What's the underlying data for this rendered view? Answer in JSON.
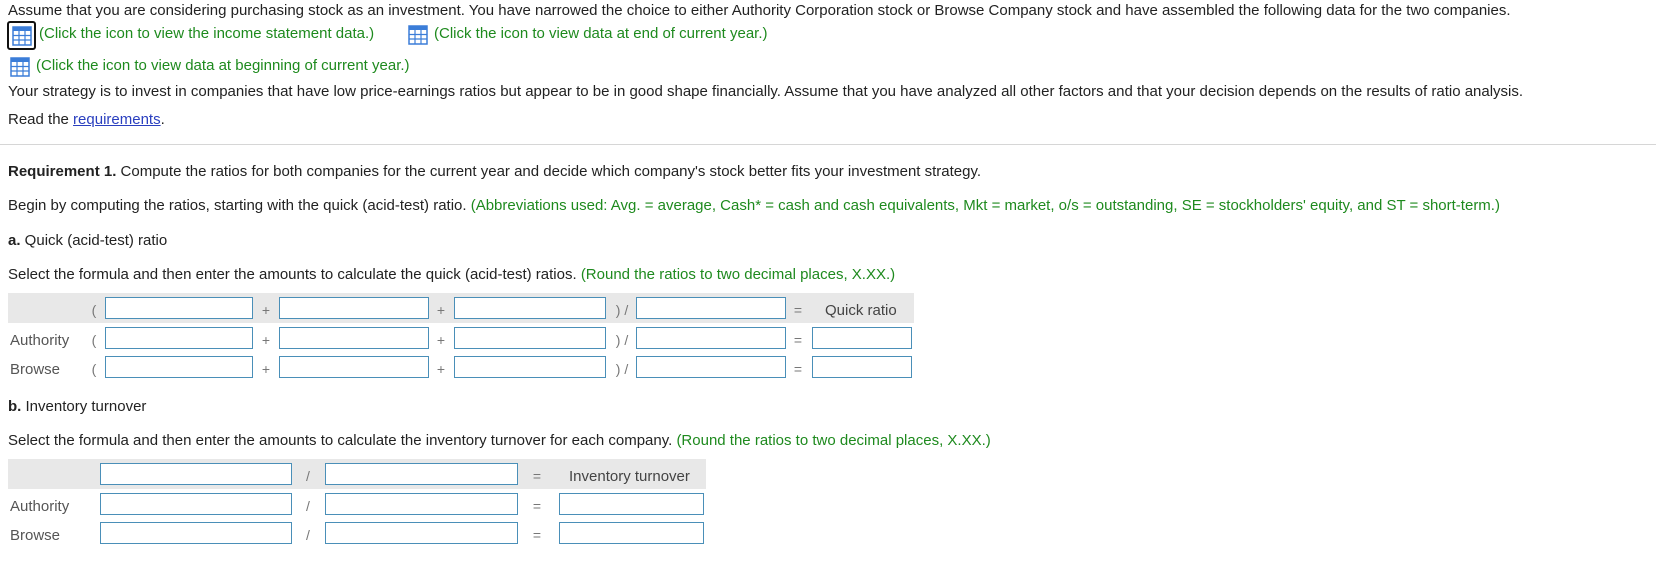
{
  "intro": {
    "text": "Assume that you are considering purchasing stock as an investment. You have narrowed the choice to either Authority Corporation stock or Browse Company stock and have assembled the following data for the two companies.",
    "link_income": "(Click the icon to view the income statement data.)",
    "link_end": "(Click the icon to view data at end of current year.)",
    "link_begin": "(Click the icon to view data at beginning of current year.)",
    "strategy": "Your strategy is to invest in companies that have low price-earnings ratios but appear to be in good shape financially. Assume that you have analyzed all other factors and that your decision depends on the results of ratio analysis.",
    "read_prefix": "Read the ",
    "read_link": "requirements",
    "read_suffix": "."
  },
  "requirement": {
    "label": "Requirement 1.",
    "text": " Compute the ratios for both companies for the current year and decide which company's stock better fits your investment strategy.",
    "begin_text": "Begin by computing the ratios, starting with the quick (acid-test) ratio. ",
    "abbrev": "(Abbreviations used: Avg. = average, Cash* = cash and cash equivalents, Mkt = market, o/s = outstanding, SE = stockholders' equity, and ST = short-term.)"
  },
  "part_a": {
    "letter": "a.",
    "title": " Quick (acid-test) ratio",
    "instruction": "Select the formula and then enter the amounts to calculate the quick (acid-test) ratios. ",
    "round_note": "(Round the ratios to two decimal places, X.XX.)",
    "open_paren": "(",
    "plus": "+",
    "close_div": ") /",
    "equals": "=",
    "result_label": "Quick ratio",
    "rows": [
      "Authority",
      "Browse"
    ]
  },
  "part_b": {
    "letter": "b.",
    "title": " Inventory turnover",
    "instruction": "Select the formula and then enter the amounts to calculate the inventory turnover for each company. ",
    "round_note": "(Round the ratios to two decimal places, X.XX.)",
    "div": "/",
    "equals": "=",
    "result_label": "Inventory turnover",
    "rows": [
      "Authority",
      "Browse"
    ]
  },
  "colors": {
    "link_green": "#1e8a1e",
    "link_blue": "#2a3fbf",
    "input_border": "#4a8fb8",
    "header_band": "#e8e8e8"
  },
  "icons": {
    "data_table": "table-grid-icon"
  }
}
